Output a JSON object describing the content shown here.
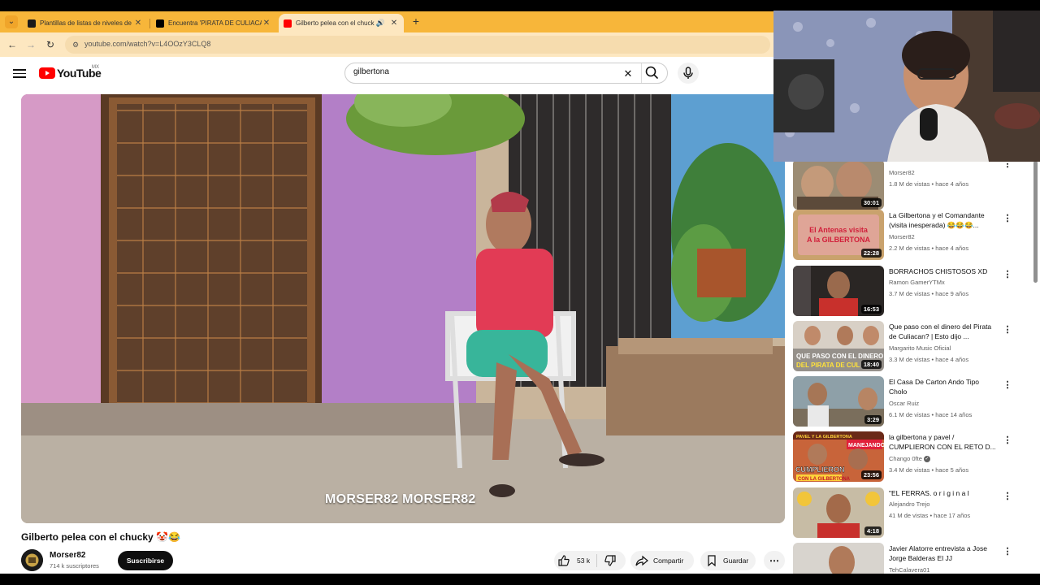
{
  "browser": {
    "tabs": [
      {
        "title": "Plantillas de listas de niveles de",
        "favicon_color": "#1a1a1a"
      },
      {
        "title": "Encuentra 'PIRATA DE CULIACA",
        "favicon_color": "#000000"
      },
      {
        "title": "Gilberto pelea con el chuck",
        "favicon_color": "#ff0000"
      }
    ],
    "active_tab": 2,
    "url": "youtube.com/watch?v=L4OOzY3CLQ8"
  },
  "youtube": {
    "logo_text": "YouTube",
    "country_code": "MX",
    "search_value": "gilbertona"
  },
  "video": {
    "watermark": "MORSER82 MORSER82",
    "title": "Gilberto pelea con el chucky 🤡😂",
    "channel_name": "Morser82",
    "subscribers": "714 k suscriptores",
    "subscribe_label": "Suscribirse",
    "likes": "53 k",
    "share_label": "Compartir",
    "save_label": "Guardar"
  },
  "recommendations": [
    {
      "title": "",
      "channel": "Morser82",
      "meta": "1.8 M de vistas • hace 4 años",
      "duration": "30:01",
      "verified": false
    },
    {
      "title": "La Gilbertona y el Comandante (visita inesperada) 😂😂😂...",
      "channel": "Morser82",
      "meta": "2.2 M de vistas • hace 4 años",
      "duration": "22:28",
      "verified": false
    },
    {
      "title": "BORRACHOS CHISTOSOS XD",
      "channel": "Ramon GamerYTMx",
      "meta": "3.7 M de vistas • hace 9 años",
      "duration": "16:53",
      "verified": false
    },
    {
      "title": "Que paso con el dinero del Pirata de Culiacan? | Esto dijo ...",
      "channel": "Margarito Music Oficial",
      "meta": "3.3 M de vistas • hace 4 años",
      "duration": "18:40",
      "verified": false
    },
    {
      "title": "El Casa De Carton Ando Tipo Cholo",
      "channel": "Oscar Ruiz",
      "meta": "6.1 M de vistas • hace 14 años",
      "duration": "3:29",
      "verified": false
    },
    {
      "title": "la gilbertona y pavel / CUMPLIERON CON EL RETO D...",
      "channel": "Chango 0fte",
      "meta": "3.4 M de vistas • hace 5 años",
      "duration": "23:56",
      "verified": true
    },
    {
      "title": "\"EL FERRAS. o r i g i n a l",
      "channel": "Alejandro Trejo",
      "meta": "41 M de vistas • hace 17 años",
      "duration": "4:18",
      "verified": false
    },
    {
      "title": "Javier Alatorre entrevista a Jose Jorge Balderas El JJ",
      "channel": "TehCalavera01",
      "meta": "",
      "duration": "",
      "verified": false
    }
  ],
  "thumb_texts": {
    "rec1": "El Antenas visita A la GILBERTONA",
    "rec3": "QUE PASO CON EL DINERO DEL PIRATA DE CUL",
    "rec5_top": "PAVEL Y LA GILBERTONA MANEJANDO",
    "rec5_bottom": "CUMPLIERON CON LA GILBERTONA"
  },
  "colors": {
    "tabstrip": "#f7b63a",
    "active_tab": "#fde7c0",
    "yt_red": "#ff0000",
    "subscribe_bg": "#0f0f0f"
  }
}
